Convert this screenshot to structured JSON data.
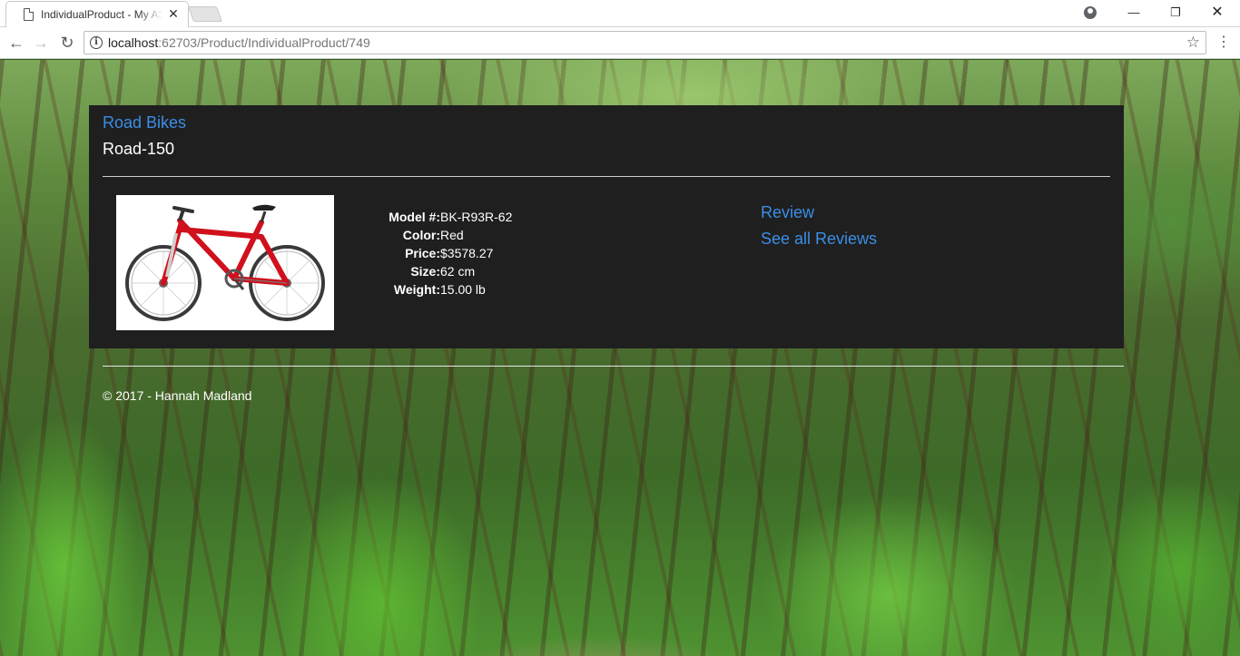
{
  "browser": {
    "tab_title": "IndividualProduct - My ASP.NET Application",
    "url_host": "localhost",
    "url_path": ":62703/Product/IndividualProduct/749",
    "icons": {
      "back": "arrow-left-icon",
      "forward": "arrow-right-icon",
      "reload": "reload-icon",
      "info": "info-icon",
      "bookmark": "star-icon",
      "menu": "kebab-menu-icon"
    }
  },
  "product": {
    "category": "Road Bikes",
    "name": "Road-150",
    "image_alt": "Red bicycle",
    "specs": [
      {
        "label": "Model #:",
        "value": "BK-R93R-62"
      },
      {
        "label": "Color:",
        "value": "Red"
      },
      {
        "label": "Price:",
        "value": "$3578.27"
      },
      {
        "label": "Size:",
        "value": "62 cm"
      },
      {
        "label": "Weight:",
        "value": "15.00 lb"
      }
    ],
    "review_label": "Review",
    "all_reviews_label": "See all Reviews"
  },
  "footer": {
    "text": "© 2017 - Hannah Madland"
  },
  "colors": {
    "link": "#3a8ee6",
    "panel_bg": "#1f1f1f",
    "bike_frame": "#d0101c"
  }
}
